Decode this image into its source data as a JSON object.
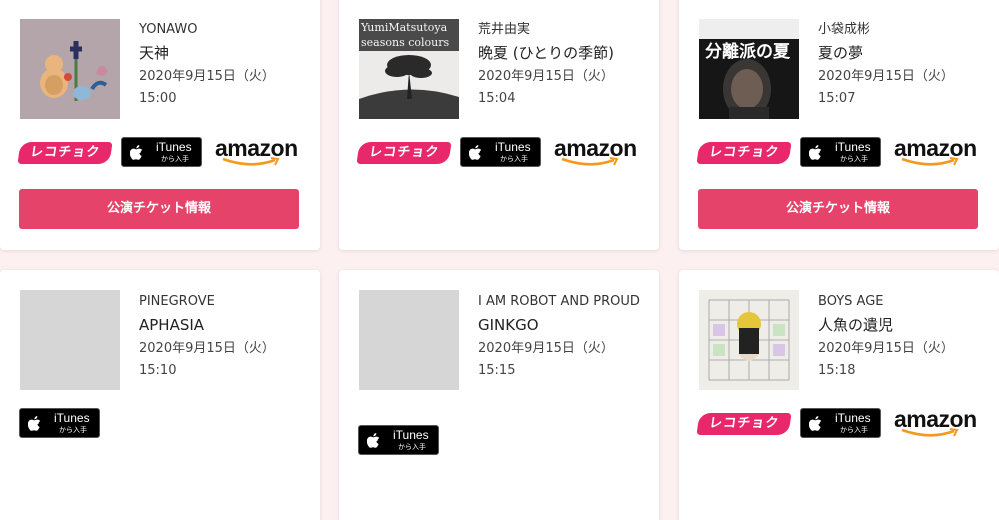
{
  "store_labels": {
    "recochoku": "レコチョク",
    "itunes_name": "iTunes",
    "itunes_sub": "から入手",
    "amazon": "amazon"
  },
  "ticket_label": "公演チケット情報",
  "colors": {
    "page_bg": "#fdf0f1",
    "ticket_button": "#e6436a",
    "recochoku": "#e8286b",
    "amazon_smile": "#f39a1e"
  },
  "songs": [
    {
      "artist": "YONAWO",
      "title": "天神",
      "date": "2020年9月15日（火）",
      "time": "15:00",
      "has_ticket": true
    },
    {
      "artist": "荒井由実",
      "title": "晩夏 (ひとりの季節)",
      "date": "2020年9月15日（火）",
      "time": "15:04",
      "jacket_text": "YumiMatsutoya seasons colours",
      "has_ticket": false
    },
    {
      "artist": "小袋成彬",
      "title": "夏の夢",
      "date": "2020年9月15日（火）",
      "time": "15:07",
      "jacket_text": "分離派の夏",
      "has_ticket": true
    },
    {
      "artist": "PINEGROVE",
      "title": "APHASIA",
      "date": "2020年9月15日（火）",
      "time": "15:10",
      "has_ticket": false
    },
    {
      "artist": "I AM ROBOT AND PROUD",
      "title": "GINKGO",
      "date": "2020年9月15日（火）",
      "time": "15:15",
      "has_ticket": false
    },
    {
      "artist": "BOYS AGE",
      "title": "人魚の遺児",
      "date": "2020年9月15日（火）",
      "time": "15:18",
      "has_ticket": false
    }
  ]
}
